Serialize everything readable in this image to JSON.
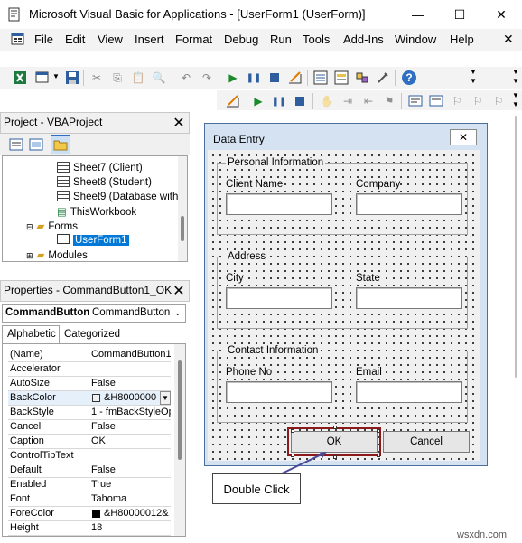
{
  "window": {
    "title": "Microsoft Visual Basic for Applications - [UserForm1 (UserForm)]",
    "minimize": "—",
    "maximize": "☐",
    "close": "✕"
  },
  "menu": {
    "items": [
      "File",
      "Edit",
      "View",
      "Insert",
      "Format",
      "Debug",
      "Run",
      "Tools",
      "Add-Ins",
      "Window",
      "Help"
    ],
    "close_glyph": "✕"
  },
  "project": {
    "title": "Project - VBAProject",
    "close": "✕",
    "tree": [
      {
        "label": "Sheet7 (Client)",
        "type": "sheet"
      },
      {
        "label": "Sheet8 (Student)",
        "type": "sheet"
      },
      {
        "label": "Sheet9 (Database with",
        "type": "sheet"
      },
      {
        "label": "ThisWorkbook",
        "type": "workbook"
      },
      {
        "label": "Forms",
        "type": "folder"
      },
      {
        "label": "UserForm1",
        "type": "form",
        "selected": true
      },
      {
        "label": "Modules",
        "type": "folder"
      }
    ]
  },
  "properties": {
    "title": "Properties - CommandButton1_OK",
    "close": "✕",
    "object_name": "CommandButton",
    "object_type": "CommandButton",
    "tabs": [
      "Alphabetic",
      "Categorized"
    ],
    "rows": [
      {
        "name": "(Name)",
        "value": "CommandButton1"
      },
      {
        "name": "Accelerator",
        "value": ""
      },
      {
        "name": "AutoSize",
        "value": "False"
      },
      {
        "name": "BackColor",
        "value": "&H8000000"
      },
      {
        "name": "BackStyle",
        "value": "1 - fmBackStyleOp"
      },
      {
        "name": "Cancel",
        "value": "False"
      },
      {
        "name": "Caption",
        "value": "OK"
      },
      {
        "name": "ControlTipText",
        "value": ""
      },
      {
        "name": "Default",
        "value": "False"
      },
      {
        "name": "Enabled",
        "value": "True"
      },
      {
        "name": "Font",
        "value": "Tahoma"
      },
      {
        "name": "ForeColor",
        "value": "&H80000012&"
      },
      {
        "name": "Height",
        "value": "18"
      }
    ]
  },
  "form": {
    "title": "Data Entry",
    "close": "✕",
    "frames": [
      {
        "caption": "Personal Information",
        "left_label": "Client Name",
        "right_label": "Company"
      },
      {
        "caption": "Address",
        "left_label": "City",
        "right_label": "State"
      },
      {
        "caption": "Contact Information",
        "left_label": "Phone No",
        "right_label": "Email"
      }
    ],
    "ok_button": "OK",
    "cancel_button": "Cancel"
  },
  "callout": "Double Click",
  "watermark": "wsxdn.com",
  "colors": {
    "highlight": "#0078d7",
    "selection_border": "#8b1a1a",
    "form_bg": "#d4e2f1"
  }
}
